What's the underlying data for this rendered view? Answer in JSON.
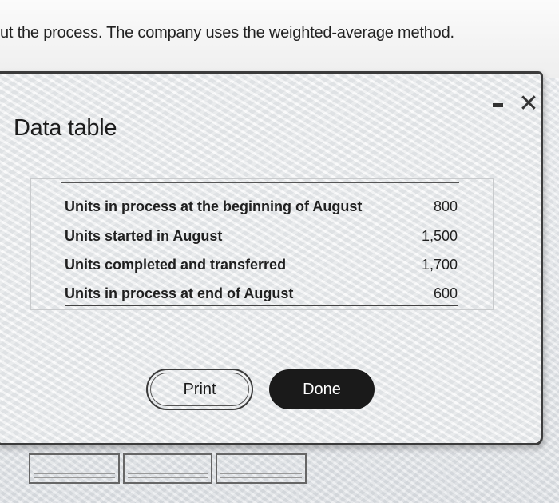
{
  "instruction": {
    "text": "ut the process. The company uses the weighted-average method."
  },
  "dialog": {
    "title": "Data table",
    "minimize_glyph": "▬",
    "close_glyph": "✕",
    "rows": [
      {
        "label": "Units in process at the beginning of August",
        "value": "800"
      },
      {
        "label": "Units started in August",
        "value": "1,500"
      },
      {
        "label": "Units completed and transferred",
        "value": "1,700"
      },
      {
        "label": "Units in process at end of August",
        "value": "600"
      }
    ],
    "buttons": {
      "print": "Print",
      "done": "Done"
    }
  },
  "icons": [
    "minimize-icon",
    "close-icon"
  ],
  "colors": {
    "done_button_bg": "#1a1a1a",
    "dialog_border": "#3b3b3b"
  }
}
